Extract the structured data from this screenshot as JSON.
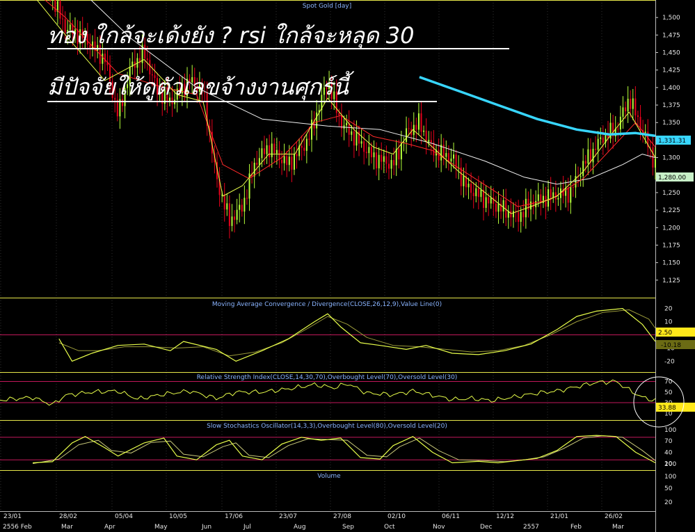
{
  "annotation": {
    "line1": "ทอง ใกล้จะเด้งยัง ? rsi ใกล้จะหลุด 30",
    "line2": "มีปัจจัยให้ดูตัวเลขจ้างงานศุกร์นี้"
  },
  "colors": {
    "bull": "#b6ff3a",
    "bear": "#e8001c",
    "ma_fast": "#e9ff4a",
    "ma_mid": "#ff2a2a",
    "ma_slow": "#f0f0f0",
    "ma_200": "#38d6ff",
    "panel_border": "#e8e84a",
    "level_line": "#c2185b"
  },
  "chart_data": [
    {
      "type": "candlestick",
      "panel": "price",
      "title": "Spot Gold [day]",
      "ylim": [
        1100,
        1525
      ],
      "yticks": [
        1125,
        1150,
        1175,
        1200,
        1225,
        1250,
        1275,
        1300,
        1325,
        1350,
        1375,
        1400,
        1425,
        1450,
        1475,
        1500
      ],
      "last_price_labels": [
        "1,331.31",
        "1,280.00"
      ],
      "series": [
        {
          "name": "Close",
          "role": "price"
        },
        {
          "name": "MA fast",
          "role": "ma_fast"
        },
        {
          "name": "MA mid",
          "role": "ma_mid"
        },
        {
          "name": "MA slow",
          "role": "ma_slow"
        },
        {
          "name": "MA 200",
          "role": "ma_200"
        }
      ],
      "close_points": [
        [
          0,
          1600
        ],
        [
          6,
          1570
        ],
        [
          10,
          1485
        ],
        [
          13,
          1470
        ],
        [
          16,
          1440
        ],
        [
          18,
          1360
        ],
        [
          20,
          1430
        ],
        [
          22,
          1450
        ],
        [
          24,
          1395
        ],
        [
          26,
          1380
        ],
        [
          29,
          1410
        ],
        [
          31,
          1395
        ],
        [
          33,
          1270
        ],
        [
          35,
          1210
        ],
        [
          37,
          1230
        ],
        [
          39,
          1295
        ],
        [
          41,
          1315
        ],
        [
          44,
          1290
        ],
        [
          47,
          1325
        ],
        [
          50,
          1410
        ],
        [
          52,
          1350
        ],
        [
          54,
          1330
        ],
        [
          57,
          1300
        ],
        [
          60,
          1290
        ],
        [
          62,
          1335
        ],
        [
          64,
          1350
        ],
        [
          66,
          1310
        ],
        [
          69,
          1300
        ],
        [
          71,
          1260
        ],
        [
          74,
          1240
        ],
        [
          77,
          1225
        ],
        [
          79,
          1215
        ],
        [
          81,
          1235
        ],
        [
          84,
          1245
        ],
        [
          87,
          1250
        ],
        [
          89,
          1290
        ],
        [
          92,
          1330
        ],
        [
          94,
          1340
        ],
        [
          96,
          1385
        ],
        [
          98,
          1340
        ],
        [
          100,
          1290
        ]
      ],
      "ma_fast_points": [
        [
          0,
          1590
        ],
        [
          10,
          1475
        ],
        [
          16,
          1410
        ],
        [
          22,
          1440
        ],
        [
          27,
          1390
        ],
        [
          31,
          1380
        ],
        [
          34,
          1245
        ],
        [
          37,
          1260
        ],
        [
          41,
          1305
        ],
        [
          45,
          1305
        ],
        [
          50,
          1385
        ],
        [
          54,
          1340
        ],
        [
          57,
          1315
        ],
        [
          60,
          1305
        ],
        [
          63,
          1340
        ],
        [
          66,
          1315
        ],
        [
          70,
          1280
        ],
        [
          74,
          1250
        ],
        [
          78,
          1220
        ],
        [
          81,
          1230
        ],
        [
          85,
          1245
        ],
        [
          89,
          1280
        ],
        [
          93,
          1330
        ],
        [
          96,
          1365
        ],
        [
          100,
          1300
        ]
      ],
      "ma_mid_points": [
        [
          0,
          1580
        ],
        [
          10,
          1500
        ],
        [
          18,
          1420
        ],
        [
          25,
          1400
        ],
        [
          30,
          1390
        ],
        [
          34,
          1290
        ],
        [
          38,
          1270
        ],
        [
          43,
          1300
        ],
        [
          48,
          1350
        ],
        [
          52,
          1360
        ],
        [
          57,
          1330
        ],
        [
          62,
          1320
        ],
        [
          66,
          1310
        ],
        [
          70,
          1285
        ],
        [
          75,
          1255
        ],
        [
          79,
          1230
        ],
        [
          84,
          1240
        ],
        [
          89,
          1270
        ],
        [
          94,
          1320
        ],
        [
          97,
          1350
        ],
        [
          100,
          1315
        ]
      ],
      "ma_slow_points": [
        [
          0,
          1650
        ],
        [
          10,
          1560
        ],
        [
          20,
          1470
        ],
        [
          30,
          1400
        ],
        [
          40,
          1355
        ],
        [
          50,
          1345
        ],
        [
          58,
          1340
        ],
        [
          66,
          1320
        ],
        [
          74,
          1295
        ],
        [
          80,
          1272
        ],
        [
          85,
          1262
        ],
        [
          90,
          1270
        ],
        [
          95,
          1290
        ],
        [
          98,
          1305
        ],
        [
          100,
          1300
        ]
      ],
      "ma_200_points": [
        [
          64,
          1415
        ],
        [
          70,
          1395
        ],
        [
          76,
          1375
        ],
        [
          82,
          1355
        ],
        [
          88,
          1340
        ],
        [
          93,
          1333
        ],
        [
          97,
          1335
        ],
        [
          100,
          1331
        ]
      ]
    },
    {
      "type": "line",
      "panel": "macd",
      "title": "Moving Average Convergence / Divergence(CLOSE,26,12,9),Value Line(0)",
      "ylim": [
        -24,
        24
      ],
      "yticks": [
        -20,
        -10,
        10,
        20
      ],
      "last_value_labels": [
        "2.50",
        "-10.18"
      ],
      "series": [
        {
          "name": "MACD",
          "points": [
            [
              9,
              -3
            ],
            [
              11,
              -20
            ],
            [
              14,
              -14
            ],
            [
              18,
              -8
            ],
            [
              22,
              -7
            ],
            [
              26,
              -12
            ],
            [
              28,
              -5
            ],
            [
              33,
              -11
            ],
            [
              36,
              -20
            ],
            [
              40,
              -12
            ],
            [
              44,
              -3
            ],
            [
              48,
              10
            ],
            [
              50,
              16
            ],
            [
              52,
              6
            ],
            [
              55,
              -6
            ],
            [
              58,
              -8
            ],
            [
              62,
              -11
            ],
            [
              65,
              -8
            ],
            [
              69,
              -14
            ],
            [
              73,
              -15
            ],
            [
              77,
              -12
            ],
            [
              81,
              -7
            ],
            [
              85,
              4
            ],
            [
              88,
              14
            ],
            [
              91,
              18
            ],
            [
              95,
              20
            ],
            [
              98,
              8
            ],
            [
              100,
              -5
            ]
          ]
        },
        {
          "name": "Signal",
          "points": [
            [
              9,
              -6
            ],
            [
              12,
              -12
            ],
            [
              15,
              -12
            ],
            [
              19,
              -9
            ],
            [
              23,
              -9
            ],
            [
              27,
              -10
            ],
            [
              31,
              -9
            ],
            [
              35,
              -16
            ],
            [
              39,
              -13
            ],
            [
              43,
              -6
            ],
            [
              47,
              5
            ],
            [
              50,
              14
            ],
            [
              53,
              8
            ],
            [
              56,
              -2
            ],
            [
              60,
              -8
            ],
            [
              64,
              -9
            ],
            [
              68,
              -11
            ],
            [
              72,
              -13
            ],
            [
              76,
              -12
            ],
            [
              80,
              -8
            ],
            [
              84,
              0
            ],
            [
              88,
              10
            ],
            [
              92,
              17
            ],
            [
              96,
              19
            ],
            [
              99,
              12
            ],
            [
              100,
              5
            ]
          ]
        }
      ]
    },
    {
      "type": "line",
      "panel": "rsi",
      "title": "Relative Strength Index(CLOSE,14,30,70),Overbought Level(70),Oversold Level(30)",
      "ylim": [
        0,
        85
      ],
      "yticks": [
        10,
        30,
        50,
        70
      ],
      "levels": [
        70,
        30
      ],
      "last_value_label": "33.88",
      "series": [
        {
          "name": "RSI",
          "points": [
            [
              0,
              35
            ],
            [
              5,
              40
            ],
            [
              8,
              26
            ],
            [
              10,
              44
            ],
            [
              14,
              50
            ],
            [
              18,
              52
            ],
            [
              21,
              37
            ],
            [
              25,
              46
            ],
            [
              29,
              52
            ],
            [
              33,
              38
            ],
            [
              36,
              50
            ],
            [
              40,
              50
            ],
            [
              44,
              56
            ],
            [
              48,
              64
            ],
            [
              51,
              58
            ],
            [
              53,
              66
            ],
            [
              56,
              48
            ],
            [
              60,
              45
            ],
            [
              63,
              52
            ],
            [
              66,
              44
            ],
            [
              69,
              36
            ],
            [
              72,
              38
            ],
            [
              75,
              34
            ],
            [
              79,
              42
            ],
            [
              82,
              48
            ],
            [
              85,
              52
            ],
            [
              88,
              60
            ],
            [
              91,
              68
            ],
            [
              94,
              70
            ],
            [
              96,
              54
            ],
            [
              98,
              40
            ],
            [
              100,
              34
            ]
          ]
        }
      ]
    },
    {
      "type": "line",
      "panel": "stochastic",
      "title": "Slow Stochastics Oscillator(14,3,3),Overbought Level(80),Oversold Level(20)",
      "ylim": [
        0,
        100
      ],
      "yticks": [
        10,
        40,
        70,
        100
      ],
      "levels": [
        80,
        20
      ],
      "series": [
        {
          "name": "%K",
          "points": [
            [
              5,
              12
            ],
            [
              8,
              15
            ],
            [
              11,
              65
            ],
            [
              13,
              82
            ],
            [
              16,
              52
            ],
            [
              18,
              30
            ],
            [
              22,
              65
            ],
            [
              25,
              78
            ],
            [
              27,
              30
            ],
            [
              30,
              20
            ],
            [
              33,
              60
            ],
            [
              35,
              72
            ],
            [
              37,
              30
            ],
            [
              40,
              20
            ],
            [
              43,
              62
            ],
            [
              46,
              80
            ],
            [
              49,
              72
            ],
            [
              52,
              78
            ],
            [
              55,
              26
            ],
            [
              58,
              22
            ],
            [
              60,
              58
            ],
            [
              63,
              82
            ],
            [
              66,
              40
            ],
            [
              69,
              12
            ],
            [
              73,
              16
            ],
            [
              76,
              12
            ],
            [
              79,
              18
            ],
            [
              82,
              24
            ],
            [
              85,
              45
            ],
            [
              88,
              82
            ],
            [
              91,
              85
            ],
            [
              94,
              82
            ],
            [
              97,
              40
            ],
            [
              100,
              12
            ]
          ]
        },
        {
          "name": "%D",
          "points": [
            [
              5,
              10
            ],
            [
              9,
              22
            ],
            [
              12,
              60
            ],
            [
              15,
              72
            ],
            [
              17,
              45
            ],
            [
              20,
              38
            ],
            [
              23,
              66
            ],
            [
              26,
              70
            ],
            [
              28,
              35
            ],
            [
              31,
              28
            ],
            [
              34,
              55
            ],
            [
              36,
              65
            ],
            [
              38,
              32
            ],
            [
              41,
              26
            ],
            [
              44,
              58
            ],
            [
              47,
              76
            ],
            [
              50,
              74
            ],
            [
              53,
              72
            ],
            [
              56,
              32
            ],
            [
              59,
              28
            ],
            [
              61,
              55
            ],
            [
              64,
              78
            ],
            [
              67,
              44
            ],
            [
              70,
              20
            ],
            [
              74,
              18
            ],
            [
              77,
              15
            ],
            [
              80,
              20
            ],
            [
              83,
              28
            ],
            [
              86,
              50
            ],
            [
              89,
              78
            ],
            [
              92,
              84
            ],
            [
              95,
              80
            ],
            [
              98,
              45
            ],
            [
              100,
              18
            ]
          ]
        }
      ]
    },
    {
      "type": "bar",
      "panel": "volume",
      "title": "Volume",
      "yticks": [
        20,
        50,
        100,
        200
      ],
      "values": []
    }
  ],
  "x_axis": {
    "dates": [
      "23/01",
      "28/02",
      "05/04",
      "10/05",
      "17/06",
      "23/07",
      "27/08",
      "02/10",
      "06/11",
      "12/12",
      "21/01",
      "26/02"
    ],
    "months": [
      "2556 Feb",
      "Mar",
      "Apr",
      "May",
      "Jun",
      "Jul",
      "Aug",
      "Sep",
      "Oct",
      "Nov",
      "Dec",
      "2557",
      "Feb",
      "Mar"
    ]
  }
}
